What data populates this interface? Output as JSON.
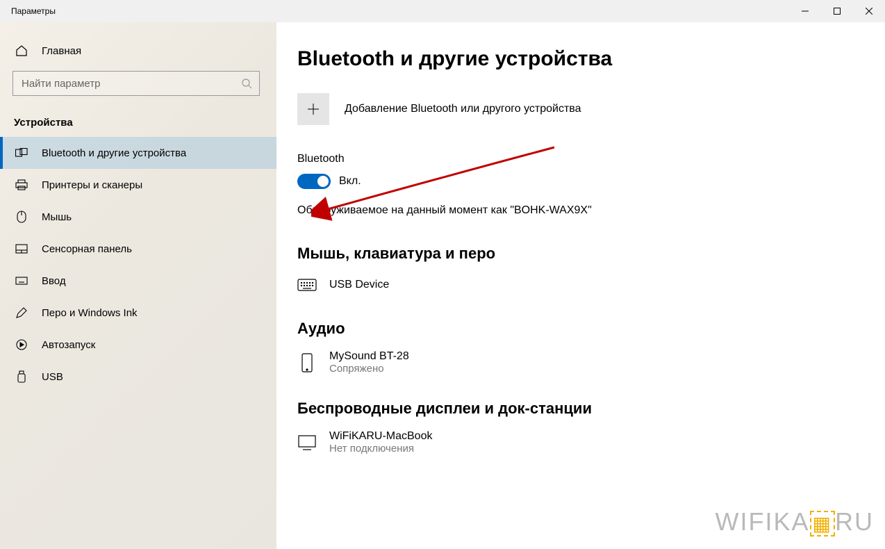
{
  "window": {
    "title": "Параметры"
  },
  "sidebar": {
    "home_label": "Главная",
    "search_placeholder": "Найти параметр",
    "section_label": "Устройства",
    "items": [
      {
        "label": "Bluetooth и другие устройства",
        "icon": "devices-icon",
        "active": true
      },
      {
        "label": "Принтеры и сканеры",
        "icon": "printer-icon",
        "active": false
      },
      {
        "label": "Мышь",
        "icon": "mouse-icon",
        "active": false
      },
      {
        "label": "Сенсорная панель",
        "icon": "touchpad-icon",
        "active": false
      },
      {
        "label": "Ввод",
        "icon": "keyboard-icon",
        "active": false
      },
      {
        "label": "Перо и Windows Ink",
        "icon": "pen-icon",
        "active": false
      },
      {
        "label": "Автозапуск",
        "icon": "autoplay-icon",
        "active": false
      },
      {
        "label": "USB",
        "icon": "usb-icon",
        "active": false
      }
    ]
  },
  "main": {
    "page_title": "Bluetooth и другие устройства",
    "add_device_label": "Добавление Bluetooth или другого устройства",
    "bluetooth": {
      "heading": "Bluetooth",
      "toggle_state": "on",
      "toggle_label": "Вкл.",
      "discoverable_text": "Обнаруживаемое на данный момент как \"BOHK-WAX9X\""
    },
    "sections": [
      {
        "title": "Мышь, клавиатура и перо",
        "devices": [
          {
            "name": "USB Device",
            "status": "",
            "icon": "keyboard-device-icon"
          }
        ]
      },
      {
        "title": "Аудио",
        "devices": [
          {
            "name": "MySound BT-28",
            "status": "Сопряжено",
            "icon": "phone-device-icon"
          }
        ]
      },
      {
        "title": "Беспроводные дисплеи и док-станции",
        "devices": [
          {
            "name": "WiFiKARU-MacBook",
            "status": "Нет подключения",
            "icon": "monitor-device-icon"
          }
        ]
      }
    ]
  },
  "watermark": {
    "text_left": "WIFIKA",
    "text_right": "RU"
  },
  "annotation": {
    "arrow_color": "#c00000"
  }
}
